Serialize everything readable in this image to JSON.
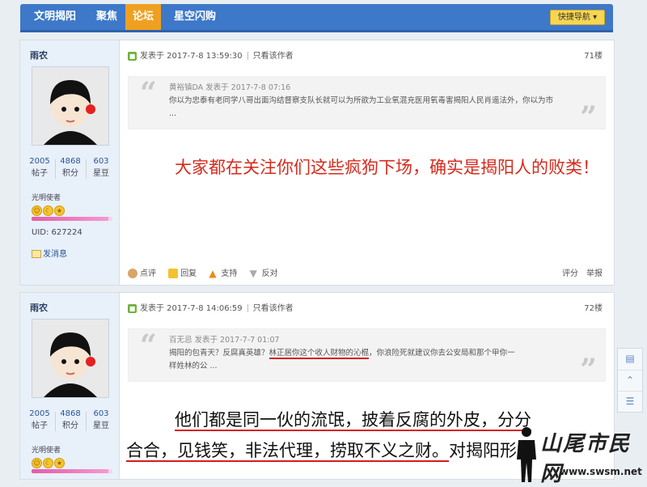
{
  "nav": {
    "items": [
      {
        "label": "文明揭阳",
        "active": false
      },
      {
        "label": "聚焦",
        "active": false
      },
      {
        "label": "论坛",
        "active": true
      },
      {
        "label": "星空闪购",
        "active": false
      }
    ],
    "quick_nav_label": "快捷导航"
  },
  "posts": [
    {
      "author": "雨农",
      "stats": [
        {
          "value": "2005",
          "label": "帖子"
        },
        {
          "value": "4868",
          "label": "积分"
        },
        {
          "value": "603",
          "label": "星豆"
        }
      ],
      "rank": "光明使者",
      "uid": "UID: 627224",
      "send_message": "发消息",
      "posted": "发表于 2017-7-8 13:59:30",
      "only_author": "只看该作者",
      "floor": "71楼",
      "quote_author": "黄裕镇DA 发表于 2017-7-8 07:16",
      "quote_text": "你以为忠泰有老同学八哥出面沟结督察支队长就可以为所欲为工业氧混充医用氧毒害揭阳人民肖遥法外，你以为市 ...",
      "body": "大家都在关注你们这些疯狗下场，确实是揭阳人的败类！",
      "actions": {
        "comment": "点评",
        "reply": "回复",
        "support": "支持",
        "oppose": "反对",
        "rate": "评分",
        "report": "举报"
      }
    },
    {
      "author": "雨农",
      "stats": [
        {
          "value": "2005",
          "label": "帖子"
        },
        {
          "value": "4868",
          "label": "积分"
        },
        {
          "value": "603",
          "label": "星豆"
        }
      ],
      "rank": "光明使者",
      "posted": "发表于 2017-7-8 14:06:59",
      "only_author": "只看该作者",
      "floor": "72楼",
      "quote_author": "百无忌 发表于 2017-7-7 01:07",
      "quote_line1_a": "揭阳的包青天？反腐真英雄？",
      "quote_line1_b": "林正居你这个收人财物的沁棍",
      "quote_line1_c": "，你浪险死就建议你去公安局和那个甲你一",
      "quote_line2": "样姓林的公 ...",
      "body_line1": "他们都是同一伙的流氓，披着反腐的外皮，分分",
      "body_line2_a": "合合，见钱笑，非法代理，捞取不义之财。",
      "body_line2_b": "对揭阳形象"
    }
  ],
  "watermark": {
    "text": "山尾市民网",
    "url": "www.swsm.net"
  },
  "colors": {
    "nav_bg": "#3d78c9",
    "nav_active": "#f0a020",
    "red_text": "#d62a1c",
    "underline": "#d71c1c"
  }
}
